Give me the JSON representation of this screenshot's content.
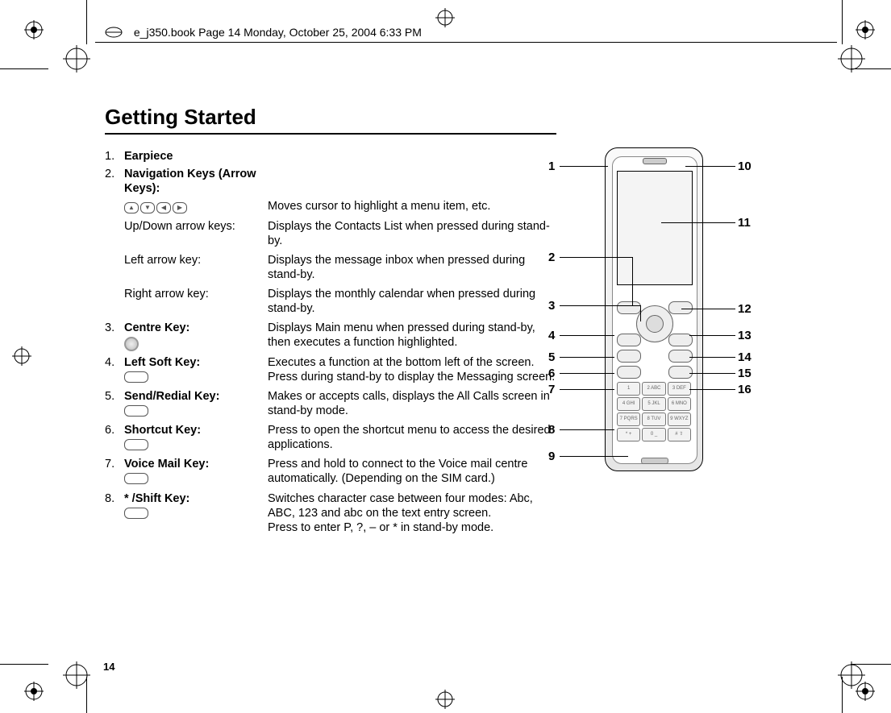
{
  "header": "e_j350.book  Page 14  Monday, October 25, 2004  6:33 PM",
  "title": "Getting Started",
  "page_number": "14",
  "items": [
    {
      "num": "1.",
      "label": "Earpiece",
      "desc": ""
    },
    {
      "num": "2.",
      "label": "Navigation Keys (Arrow Keys):",
      "desc": ""
    }
  ],
  "nav_sub": [
    {
      "label": "",
      "desc": "Moves cursor to highlight a menu item, etc.",
      "icons": true
    },
    {
      "label": "Up/Down arrow keys:",
      "desc": "Displays the Contacts List when pressed during stand-by."
    },
    {
      "label": "Left arrow key:",
      "desc": "Displays the message inbox when pressed during stand-by."
    },
    {
      "label": "Right arrow key:",
      "desc": "Displays the monthly calendar when pressed during stand-by."
    }
  ],
  "rest": [
    {
      "num": "3.",
      "label": "Centre Key:",
      "icon": "circle",
      "desc": "Displays Main menu when pressed during stand-by, then executes a function highlighted."
    },
    {
      "num": "4.",
      "label": "Left Soft Key:",
      "icon": "pill",
      "desc": "Executes a function at the bottom left of the screen.\nPress during stand-by to display the Messaging screen."
    },
    {
      "num": "5.",
      "label": "Send/Redial Key:",
      "icon": "pill",
      "desc": "Makes or accepts calls, displays the All Calls screen in stand-by mode."
    },
    {
      "num": "6.",
      "label": "Shortcut Key:",
      "icon": "pill",
      "desc": "Press to open the shortcut menu to access the desired applications."
    },
    {
      "num": "7.",
      "label": "Voice Mail Key:",
      "icon": "pill",
      "desc": "Press and hold to connect to the Voice mail centre automatically. (Depending on the SIM card.)"
    },
    {
      "num": "8.",
      "label": "* /Shift Key:",
      "icon": "pill",
      "desc": "Switches character case between four modes: Abc, ABC, 123 and abc on the text entry screen.\nPress to enter P, ?, – or * in stand-by mode."
    }
  ],
  "callouts_left": [
    "1",
    "2",
    "3",
    "4",
    "5",
    "6",
    "7",
    "8",
    "9"
  ],
  "callouts_right": [
    "10",
    "11",
    "12",
    "13",
    "14",
    "15",
    "16"
  ],
  "keypad": [
    [
      "1",
      "2 ABC",
      "3 DEF"
    ],
    [
      "4 GHI",
      "5 JKL",
      "6 MNO"
    ],
    [
      "7 PQRS",
      "8 TUV",
      "9 WXYZ"
    ],
    [
      "* +",
      "0 _",
      "# ⇧"
    ]
  ]
}
